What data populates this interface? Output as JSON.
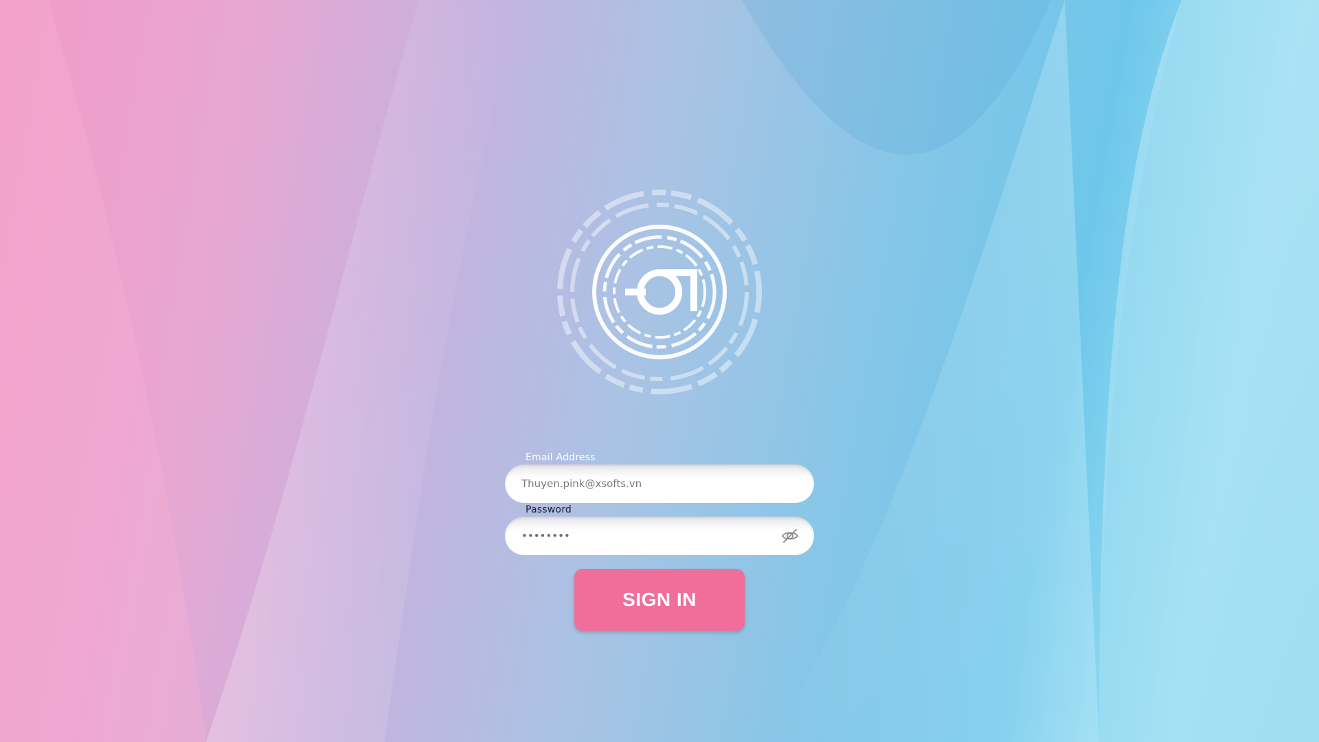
{
  "form": {
    "email_label": "Email Address",
    "email_placeholder": "Thuyen.pink@xsofts.vn",
    "email_value": "",
    "password_label": "Password",
    "password_value": "••••••••",
    "signin_label": "SIGN IN"
  },
  "icons": {
    "logo": "circular-a-logo",
    "eye": "eye-off-icon"
  },
  "colors": {
    "button": "#f06e9a",
    "label": "#ffffff",
    "password_label": "#1c1c2a"
  }
}
